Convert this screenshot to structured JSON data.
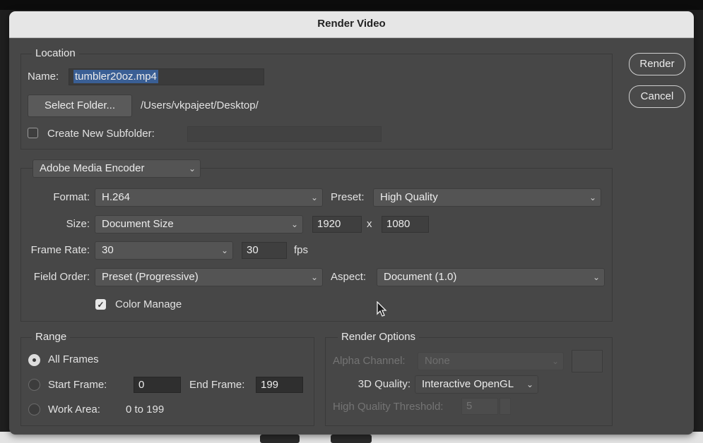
{
  "dialog": {
    "title": "Render Video",
    "render_label": "Render",
    "cancel_label": "Cancel"
  },
  "location": {
    "group_label": "Location",
    "name_label": "Name:",
    "name_value": "tumbler20oz.mp4",
    "select_folder_label": "Select Folder...",
    "folder_path": "/Users/vkpajeet/Desktop/",
    "subfolder_label": "Create New Subfolder:",
    "subfolder_checked": false,
    "subfolder_value": ""
  },
  "encoder": {
    "selected": "Adobe Media Encoder",
    "format_label": "Format:",
    "format_value": "H.264",
    "preset_label": "Preset:",
    "preset_value": "High Quality",
    "size_label": "Size:",
    "size_value": "Document Size",
    "width": "1920",
    "x_sep": "x",
    "height": "1080",
    "frame_rate_label": "Frame Rate:",
    "frame_rate_value": "30",
    "fps_value": "30",
    "fps_label": "fps",
    "field_order_label": "Field Order:",
    "field_order_value": "Preset (Progressive)",
    "aspect_label": "Aspect:",
    "aspect_value": "Document (1.0)",
    "color_manage_label": "Color Manage",
    "color_manage_checked": true
  },
  "range": {
    "group_label": "Range",
    "all_frames_label": "All Frames",
    "start_frame_label": "Start Frame:",
    "start_frame_value": "0",
    "end_frame_label": "End Frame:",
    "end_frame_value": "199",
    "work_area_label": "Work Area:",
    "work_area_value": "0 to 199",
    "selected": "all_frames"
  },
  "render_options": {
    "group_label": "Render Options",
    "alpha_label": "Alpha Channel:",
    "alpha_value": "None",
    "quality_label": "3D Quality:",
    "quality_value": "Interactive OpenGL",
    "threshold_label": "High Quality Threshold:",
    "threshold_value": "5"
  },
  "icons": {
    "chevron": "chevron-down-icon",
    "check": "checkmark-icon",
    "cursor": "mouse-pointer-icon"
  },
  "colors": {
    "dialog_bg": "#474747",
    "titlebar_bg": "#e6e6e6",
    "selection_blue": "#3a5f95"
  }
}
